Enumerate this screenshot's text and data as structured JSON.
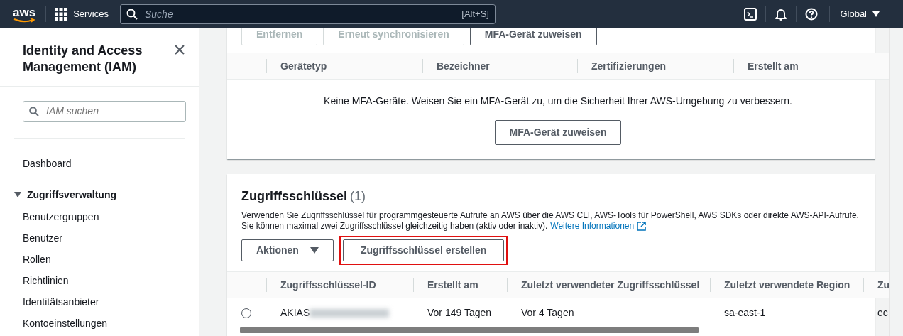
{
  "top_nav": {
    "logo": "aws",
    "services": "Services",
    "search": {
      "placeholder": "Suche",
      "shortcut": "[Alt+S]"
    },
    "region": "Global"
  },
  "sidebar": {
    "title": "Identity and Access Management (IAM)",
    "search": {
      "placeholder": "IAM suchen"
    },
    "items": [
      {
        "kind": "link",
        "label": "Dashboard"
      },
      {
        "kind": "section",
        "label": "Zugriffsverwaltung",
        "expanded": true,
        "children": [
          {
            "label": "Benutzergruppen"
          },
          {
            "label": "Benutzer"
          },
          {
            "label": "Rollen"
          },
          {
            "label": "Richtlinien"
          },
          {
            "label": "Identitätsanbieter"
          },
          {
            "label": "Kontoeinstellungen"
          }
        ]
      }
    ]
  },
  "mfa_panel": {
    "buttons": [
      {
        "label": "Entfernen",
        "disabled": true
      },
      {
        "label": "Erneut synchronisieren",
        "disabled": true
      },
      {
        "label": "MFA-Gerät zuweisen",
        "disabled": false
      }
    ],
    "columns": [
      "Gerätetyp",
      "Bezeichner",
      "Zertifizierungen",
      "Erstellt am"
    ],
    "empty_message": "Keine MFA-Geräte. Weisen Sie ein MFA-Gerät zu, um die Sicherheit Ihrer AWS-Umgebung zu verbessern.",
    "empty_button": "MFA-Gerät zuweisen"
  },
  "access_keys": {
    "title": "Zugriffsschlüssel",
    "count": "(1)",
    "description_lines": [
      "Verwenden Sie Zugriffsschlüssel für programmgesteuerte Aufrufe an AWS über die AWS CLI, AWS-Tools für PowerShell, AWS SDKs oder direkte AWS-API-Aufrufe.",
      "Sie können maximal zwei Zugriffsschlüssel gleichzeitig haben (aktiv oder inaktiv)."
    ],
    "link": "Weitere Informationen",
    "buttons": [
      {
        "kind": "dropdown",
        "label": "Aktionen",
        "highlighted": false
      },
      {
        "kind": "plain",
        "label": "Zugriffsschlüssel erstellen",
        "highlighted": true
      }
    ],
    "columns": [
      "Zugriffsschlüssel-ID",
      "Erstellt am",
      "Zuletzt verwendeter Zugriffsschlüssel",
      "Zuletzt verwendete Region",
      "Zu"
    ],
    "rows": [
      {
        "selected": false,
        "id_redacted": true,
        "cells": [
          "AKIAS",
          "Vor 149 Tagen",
          "Vor 4 Tagen",
          "sa-east-1",
          "ec"
        ]
      }
    ]
  }
}
